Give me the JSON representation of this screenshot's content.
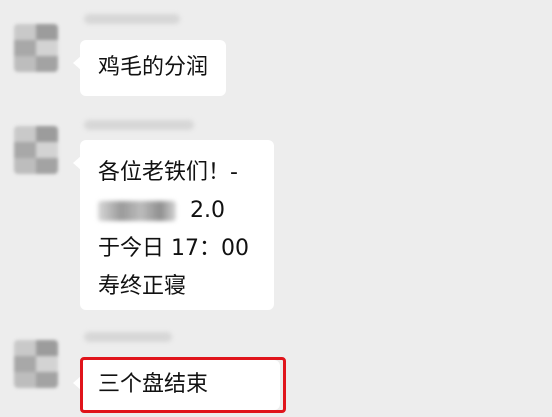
{
  "chat": {
    "messages": [
      {
        "text": "鸡毛的分润"
      },
      {
        "lines": [
          "各位老铁们！-",
          "2.0",
          "于今日 17：00",
          "寿终正寝"
        ]
      },
      {
        "text": "三个盘结束"
      }
    ]
  },
  "colors": {
    "background": "#ededed",
    "bubble": "#ffffff",
    "highlight_border": "#e0141b"
  }
}
